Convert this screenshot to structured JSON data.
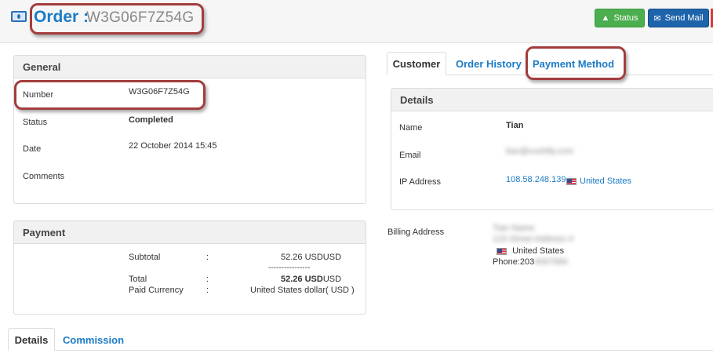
{
  "header": {
    "title_prefix": "Order :",
    "order_number": "W3G06F7Z54G",
    "status_button": "Status",
    "send_mail_button": "Send Mail"
  },
  "general": {
    "title": "General",
    "rows": [
      {
        "label": "Number",
        "value": "W3G06F7Z54G"
      },
      {
        "label": "Status",
        "value": "Completed"
      },
      {
        "label": "Date",
        "value": "22 October 2014 15:45"
      },
      {
        "label": "Comments",
        "value": ""
      }
    ]
  },
  "payment": {
    "title": "Payment",
    "subtotal_label": "Subtotal",
    "subtotal_value": "52.26 USDUSD",
    "separator": "----------------",
    "total_label": "Total",
    "total_amount": "52.26 USD",
    "total_currency": "USD",
    "paid_currency_label": "Paid Currency",
    "paid_currency_value": "United States dollar( USD )",
    "colon": ":"
  },
  "right_tabs": {
    "customer": "Customer",
    "order_history": "Order History",
    "payment_method": "Payment Method"
  },
  "details": {
    "title": "Details",
    "name_label": "Name",
    "name_value": "Tian",
    "email_label": "Email",
    "email_value": "tian@vushify.com",
    "ip_label": "IP Address",
    "ip_value": "108.58.248.139",
    "ip_country": "United States"
  },
  "billing": {
    "label": "Billing Address",
    "line1": "Tian Name",
    "line2": "123 Street Address 4",
    "country": "United States",
    "phone_label": "Phone:203",
    "phone_rest": "4567890"
  },
  "bottom_tabs": {
    "details": "Details",
    "commission": "Commission"
  }
}
